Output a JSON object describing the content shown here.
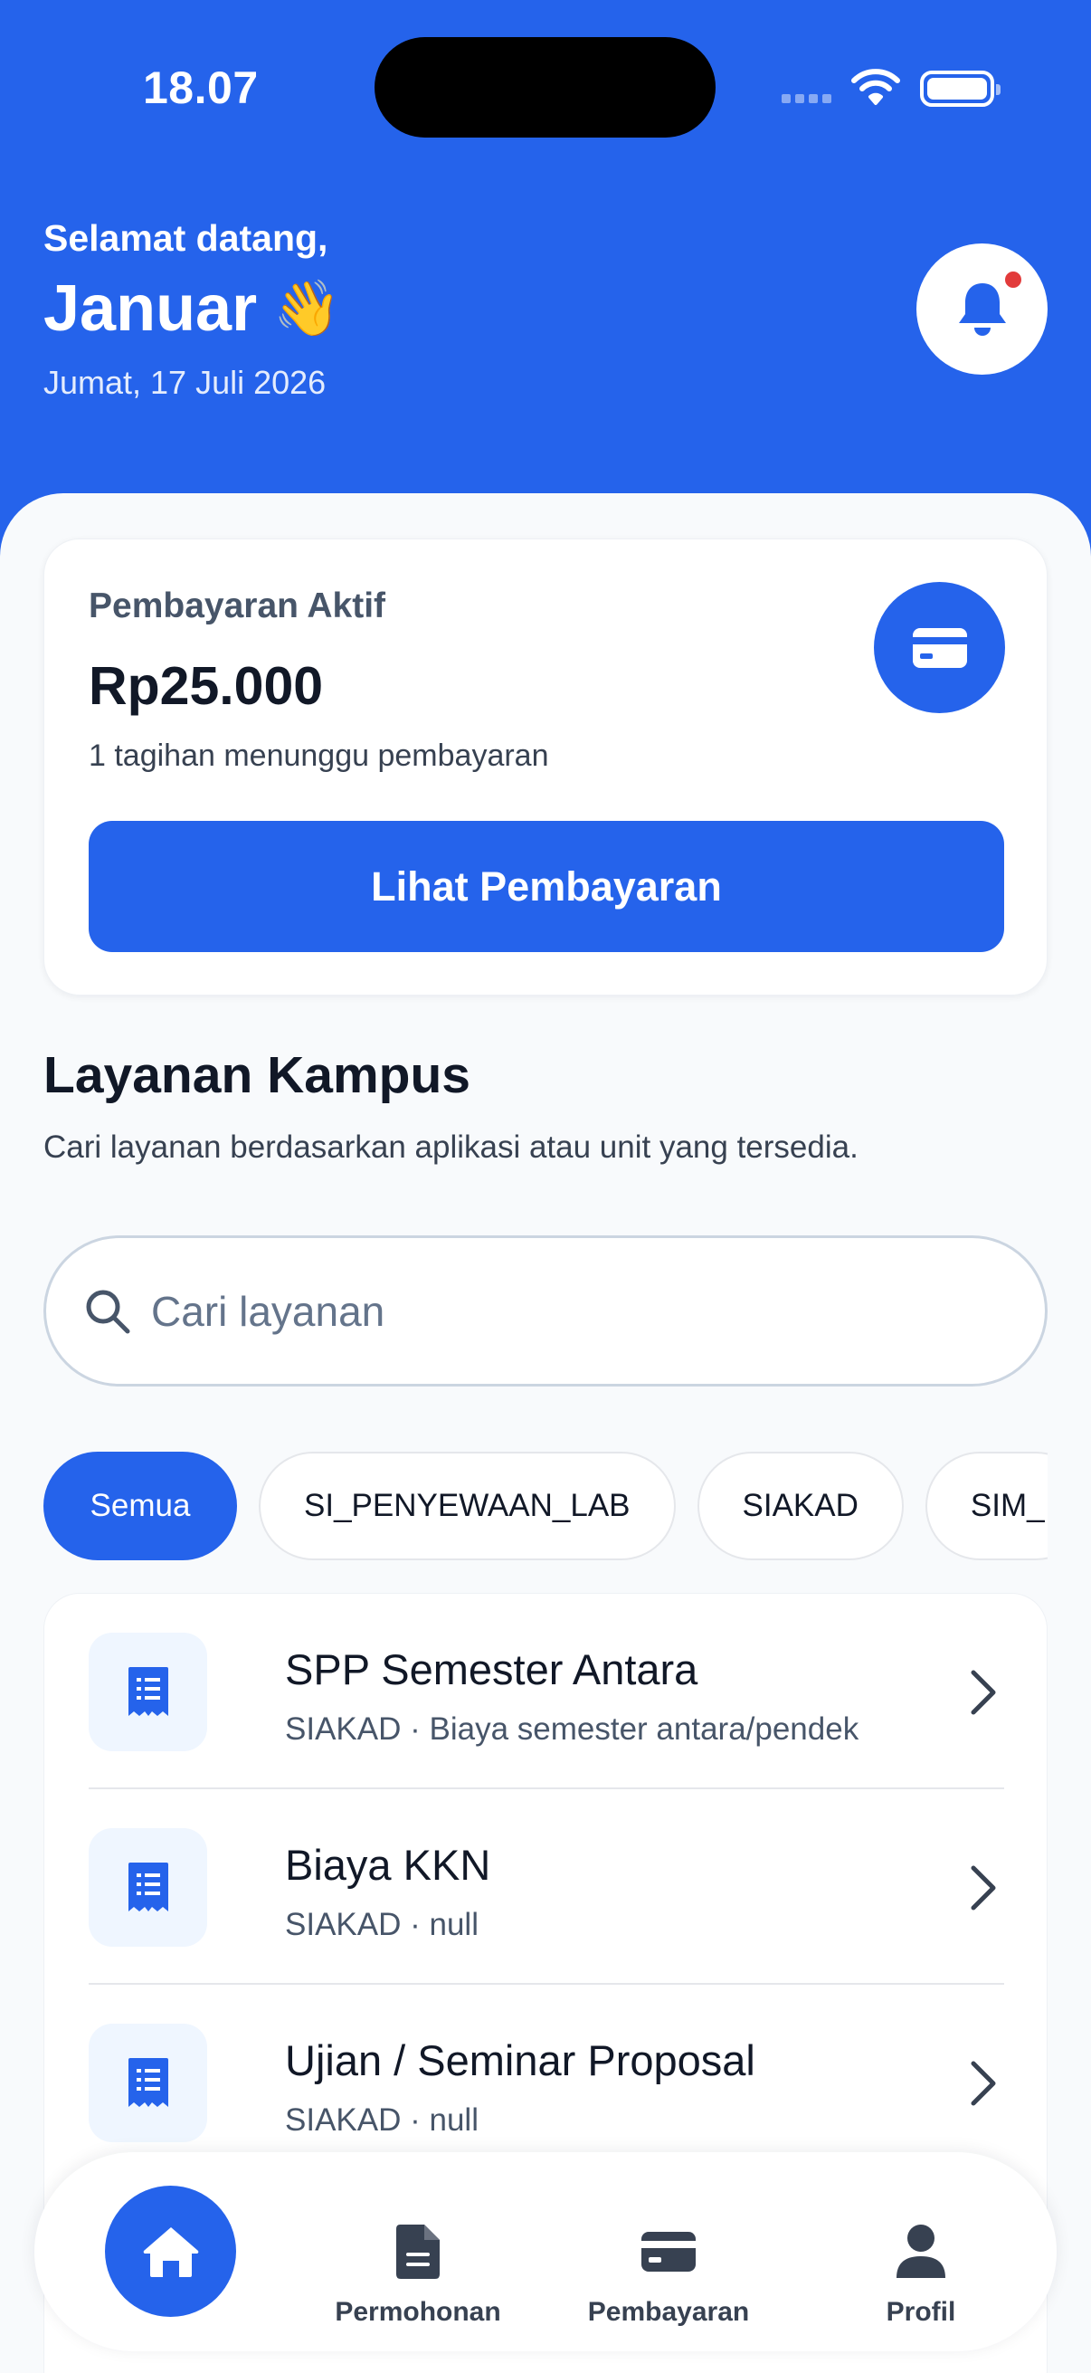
{
  "status_bar": {
    "time": "18.07"
  },
  "header": {
    "greeting": "Selamat datang,",
    "username": "Januar",
    "wave_emoji": "👋",
    "date": "Jumat, 17 Juli 2026",
    "notification_unread": true
  },
  "payment_card": {
    "title": "Pembayaran Aktif",
    "amount": "Rp25.000",
    "subtitle": "1 tagihan menunggu pembayaran",
    "button_label": "Lihat Pembayaran",
    "icon": "credit-card-icon"
  },
  "services": {
    "title": "Layanan Kampus",
    "subtitle": "Cari layanan berdasarkan aplikasi atau unit yang tersedia.",
    "search_placeholder": "Cari layanan",
    "filters": [
      {
        "label": "Semua",
        "active": true
      },
      {
        "label": "SI_PENYEWAAN_LAB",
        "active": false
      },
      {
        "label": "SIAKAD",
        "active": false
      },
      {
        "label": "SIM_",
        "active": false
      }
    ],
    "items": [
      {
        "title": "SPP Semester Antara",
        "subtitle": "SIAKAD · Biaya semester antara/pendek",
        "icon": "receipt-icon"
      },
      {
        "title": "Biaya KKN",
        "subtitle": "SIAKAD · null",
        "icon": "receipt-icon"
      },
      {
        "title": "Ujian / Seminar Proposal",
        "subtitle": "SIAKAD · null",
        "icon": "receipt-icon"
      }
    ]
  },
  "bottom_nav": {
    "items": [
      {
        "label": "",
        "icon": "home-icon",
        "active": true
      },
      {
        "label": "Permohonan",
        "icon": "document-icon",
        "active": false
      },
      {
        "label": "Pembayaran",
        "icon": "credit-card-icon",
        "active": false
      },
      {
        "label": "Profil",
        "icon": "user-icon",
        "active": false
      }
    ]
  },
  "colors": {
    "primary": "#2563EB",
    "background": "#F8FAFC",
    "notification_dot": "#E23B3B",
    "text_primary": "#111827",
    "text_secondary": "#475569"
  }
}
